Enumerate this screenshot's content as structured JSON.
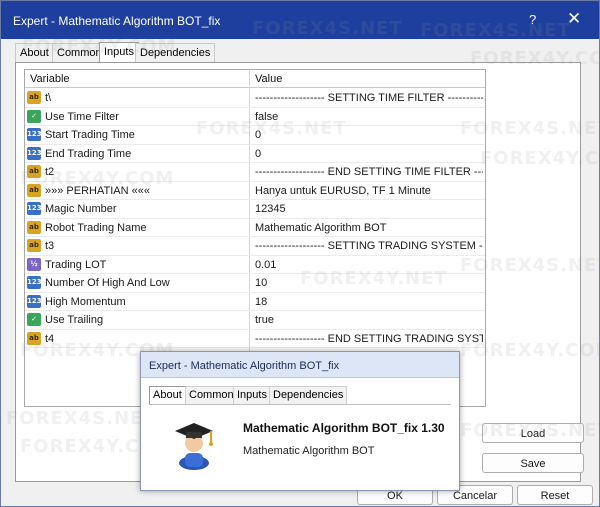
{
  "window": {
    "title": "Expert - Mathematic Algorithm BOT_fix",
    "help_glyph": "?",
    "close_glyph": "✕"
  },
  "tabs": [
    {
      "label": "About"
    },
    {
      "label": "Common"
    },
    {
      "label": "Inputs",
      "active": true
    },
    {
      "label": "Dependencies"
    }
  ],
  "table": {
    "headers": {
      "variable": "Variable",
      "value": "Value"
    },
    "rows": [
      {
        "icon": "ab",
        "variable": "t\\",
        "value": "------------------- SETTING TIME FILTER -------------------"
      },
      {
        "icon": "bool",
        "variable": "Use Time Filter",
        "value": "false"
      },
      {
        "icon": "123",
        "variable": "Start Trading Time",
        "value": "0"
      },
      {
        "icon": "123",
        "variable": "End Trading Time",
        "value": "0"
      },
      {
        "icon": "ab",
        "variable": "t2",
        "value": "------------------- END SETTING TIME FILTER -------------------"
      },
      {
        "icon": "ab",
        "variable": "»»» PERHATIAN «««",
        "value": "Hanya untuk EURUSD, TF 1 Minute"
      },
      {
        "icon": "123",
        "variable": "Magic Number",
        "value": "12345"
      },
      {
        "icon": "ab",
        "variable": "Robot Trading Name",
        "value": "Mathematic Algorithm BOT"
      },
      {
        "icon": "ab",
        "variable": "t3",
        "value": "------------------- SETTING TRADING SYSTEM -------------------"
      },
      {
        "icon": "dbl",
        "variable": "Trading LOT",
        "value": "0.01"
      },
      {
        "icon": "123",
        "variable": "Number Of High And Low",
        "value": "10"
      },
      {
        "icon": "123",
        "variable": "High Momentum",
        "value": "18"
      },
      {
        "icon": "bool",
        "variable": "Use Trailing",
        "value": "true"
      },
      {
        "icon": "ab",
        "variable": "t4",
        "value": "------------------- END SETTING TRADING SYSTEM -------------------"
      }
    ]
  },
  "buttons": {
    "load": "Load",
    "save": "Save",
    "ok": "OK",
    "cancel": "Cancelar",
    "reset": "Reset"
  },
  "about_dialog": {
    "title": "Expert - Mathematic Algorithm BOT_fix",
    "tabs": [
      {
        "label": "About",
        "active": true
      },
      {
        "label": "Common"
      },
      {
        "label": "Inputs"
      },
      {
        "label": "Dependencies"
      }
    ],
    "name": "Mathematic Algorithm BOT_fix 1.30",
    "description": "Mathematic Algorithm BOT",
    "icon": "graduate-cap-icon"
  },
  "watermarks": [
    "FOREX4S.NET",
    "FOREX4Y.COM",
    "FOREX4Y.NET"
  ],
  "colors": {
    "titlebar": "#1e3f9e",
    "dialog_titlebar": "#dce6f7"
  }
}
